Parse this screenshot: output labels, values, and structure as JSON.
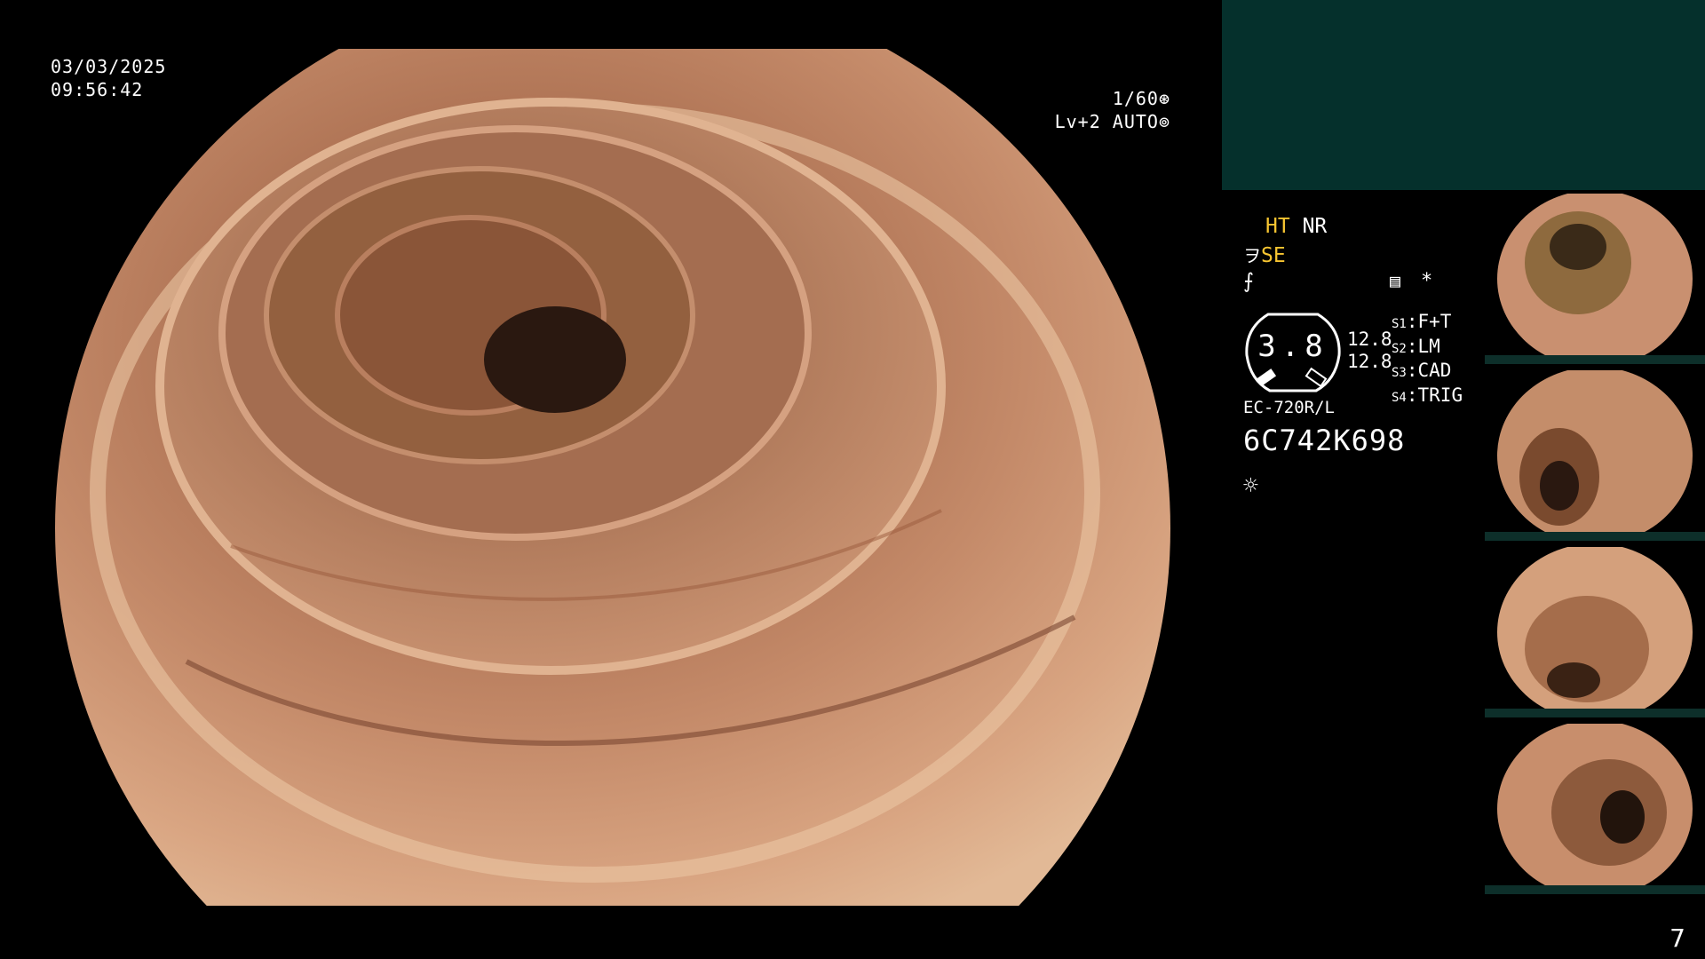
{
  "osd": {
    "date": "03/03/2025",
    "time": "09:56:42",
    "shutter": "1/60",
    "level": "Lv+2 AUTO"
  },
  "modes": {
    "ht": "HT",
    "nr": "NR",
    "se": "SE"
  },
  "gauge": {
    "value": "3.8",
    "upper": "12.8",
    "lower": "12.8"
  },
  "switches": [
    {
      "key": "S1",
      "value": "F+T"
    },
    {
      "key": "S2",
      "value": "LM"
    },
    {
      "key": "S3",
      "value": "CAD"
    },
    {
      "key": "S4",
      "value": "TRIG"
    }
  ],
  "scope": {
    "model": "EC-720R/L",
    "serial": "6C742K698"
  },
  "page": "7",
  "colors": {
    "yellow_text": "#f7c531",
    "teal_panel": "#05302c",
    "mucosa": "#c88a6a"
  },
  "icons": [
    "shutter-icon",
    "auto-iris-icon",
    "enhance-icon",
    "freeze-icon",
    "menu-icon",
    "asterisk-icon",
    "light-icon"
  ]
}
